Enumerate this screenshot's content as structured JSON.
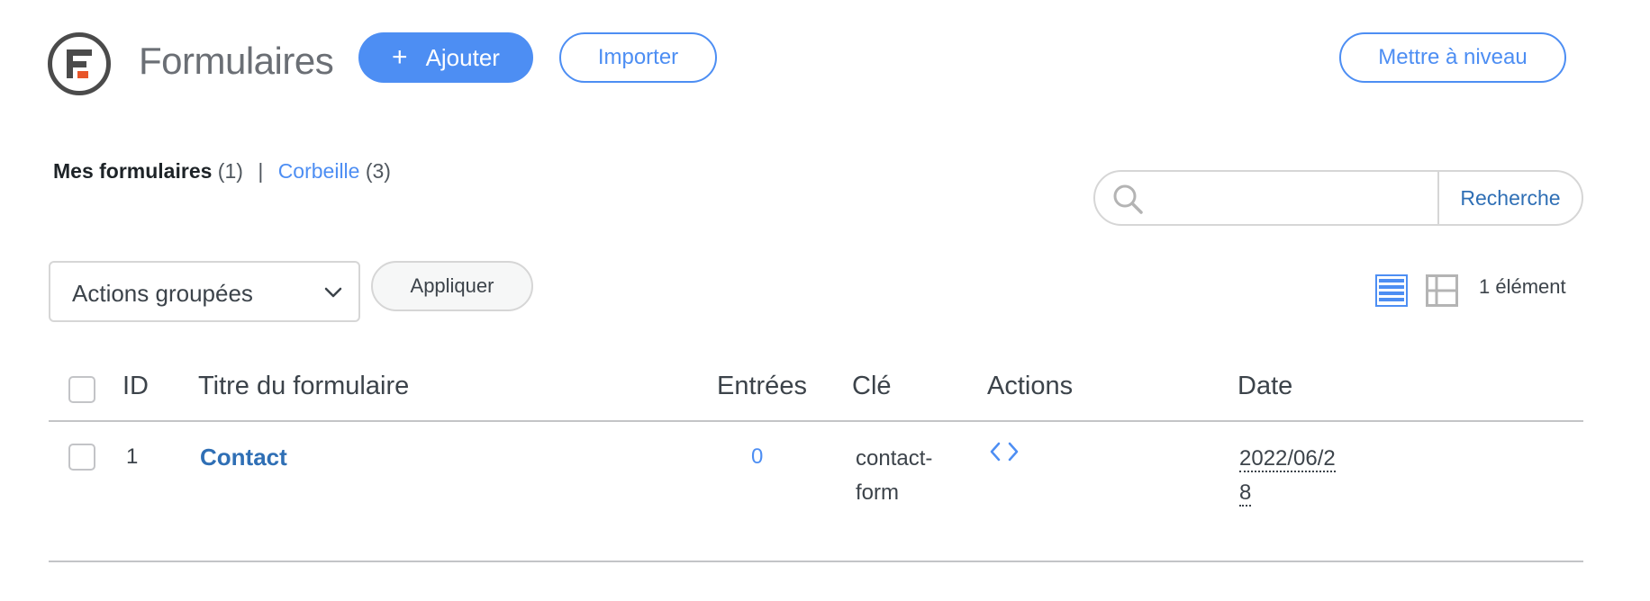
{
  "header": {
    "title": "Formulaires",
    "add_label": "Ajouter",
    "add_icon": "plus-icon",
    "import_label": "Importer",
    "upgrade_label": "Mettre à niveau",
    "brand_color": "#4d8ef3",
    "logo_accent": "#e8562a"
  },
  "filters": {
    "mine_label": "Mes formulaires",
    "mine_count": "(1)",
    "separator": "|",
    "trash_label": "Corbeille",
    "trash_count": "(3)"
  },
  "search": {
    "placeholder": "",
    "button_label": "Recherche",
    "icon": "search-icon"
  },
  "bulk": {
    "selected": "Actions groupées",
    "apply_label": "Appliquer"
  },
  "view": {
    "active": "list",
    "items_count": "1 élément"
  },
  "table": {
    "columns": [
      "ID",
      "Titre du formulaire",
      "Entrées",
      "Clé",
      "Actions",
      "Date"
    ],
    "rows": [
      {
        "id": "1",
        "title": "Contact",
        "entries": "0",
        "key": "contact-form",
        "actions": "<>",
        "date": "2022/06/28"
      }
    ]
  }
}
